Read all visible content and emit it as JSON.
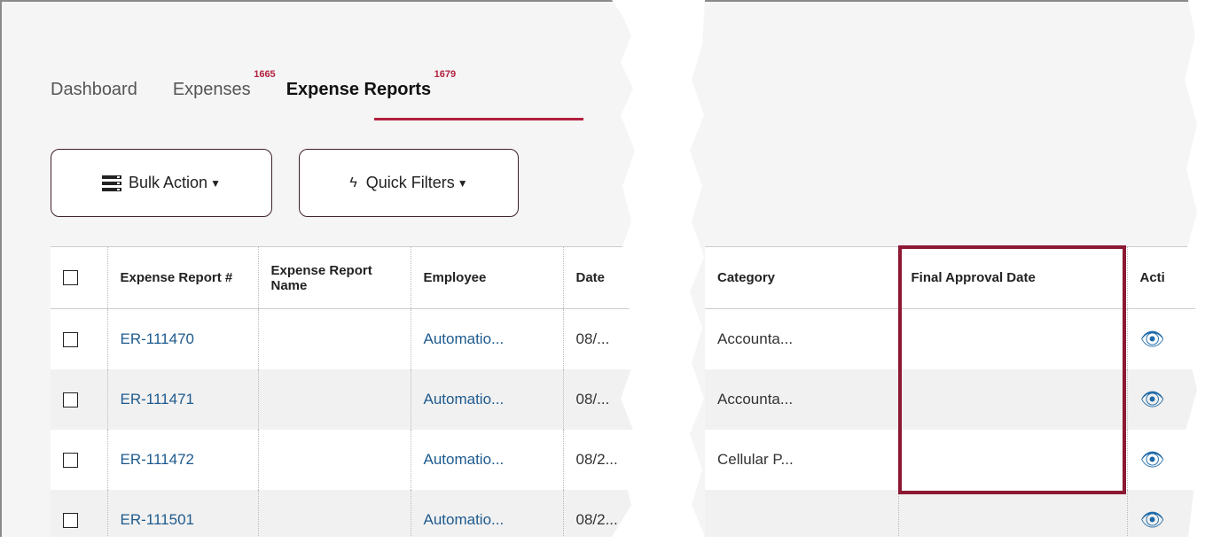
{
  "tabs": [
    {
      "label": "Dashboard",
      "badge": ""
    },
    {
      "label": "Expenses",
      "badge": "1665"
    },
    {
      "label": "Expense Reports",
      "badge": "1679"
    }
  ],
  "buttons": {
    "bulk_action": "Bulk Action",
    "quick_filters": "Quick Filters"
  },
  "icons": {
    "bulk_action": "list-stack-icon",
    "quick_filters": "lightning-icon",
    "view": "eye-icon"
  },
  "colors": {
    "accent": "#b2213f",
    "link": "#1e5a8e",
    "highlight": "#8c1833"
  },
  "table": {
    "columns_left": [
      "Expense Report #",
      "Expense Report Name",
      "Employee",
      "Date"
    ],
    "columns_right": [
      "Category",
      "Final Approval Date",
      "Acti"
    ],
    "rows": [
      {
        "report": "ER-111470",
        "name": "",
        "employee": "Automatio...",
        "date": "08/...",
        "category": "Accounta...",
        "final_approval": ""
      },
      {
        "report": "ER-111471",
        "name": "",
        "employee": "Automatio...",
        "date": "08/...",
        "category": "Accounta...",
        "final_approval": ""
      },
      {
        "report": "ER-111472",
        "name": "",
        "employee": "Automatio...",
        "date": "08/2...",
        "category": "Cellular P...",
        "final_approval": ""
      },
      {
        "report": "ER-111501",
        "name": "",
        "employee": "Automatio...",
        "date": "08/2...",
        "category": "",
        "final_approval": ""
      }
    ]
  }
}
